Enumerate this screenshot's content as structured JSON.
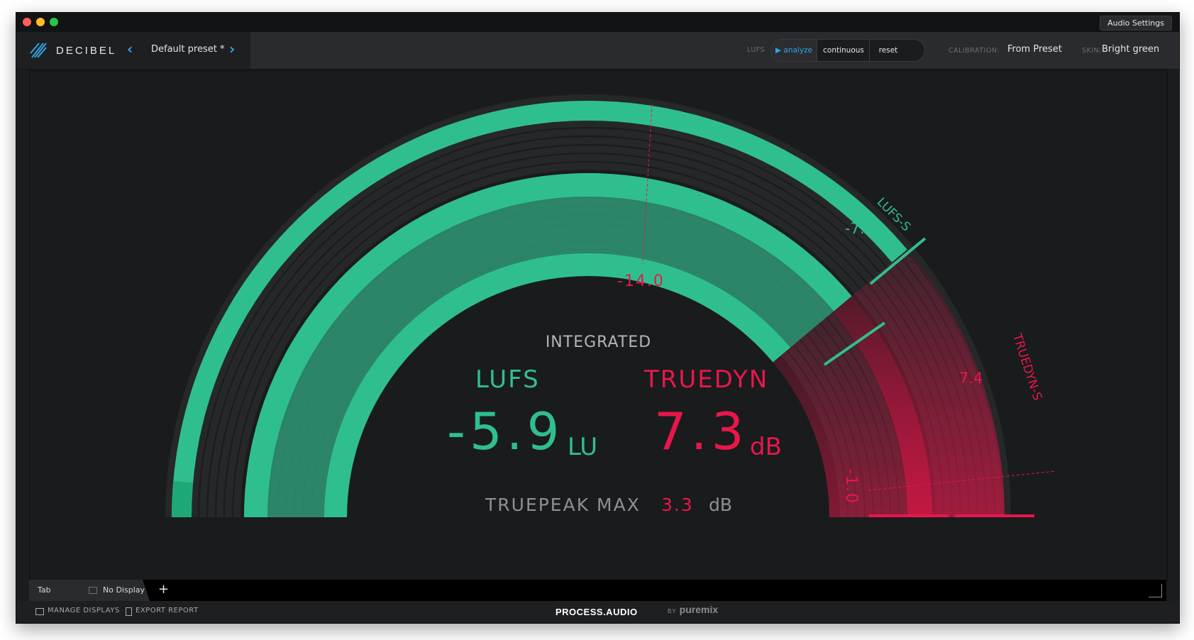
{
  "window": {
    "audio_settings_label": "Audio Settings"
  },
  "header": {
    "logo_text": "DECIBEL",
    "preset_name": "Default preset *",
    "lufs_label": "LUFS",
    "mode_buttons": [
      "analyze",
      "continuous",
      "reset"
    ],
    "active_mode": "analyze",
    "calibration_label": "CALIBRATION:",
    "calibration_value": "From Preset",
    "skin_label": "SKIN:",
    "skin_value": "Bright green"
  },
  "meter": {
    "integrated_label": "INTEGRATED",
    "lufs_title": "LUFS",
    "lufs_value": "-5.9",
    "lufs_unit": "LU",
    "truedyn_title": "TRUEDYN",
    "truedyn_value": "7.3",
    "truedyn_unit": "dB",
    "truepeak_label": "TRUEPEAK MAX",
    "truepeak_value": "3.3",
    "truepeak_unit": "dB",
    "lufs_s_label": "LUFS-S",
    "lufs_s_value": "-7.2",
    "truedyn_s_label": "TRUEDYN-S",
    "truedyn_s_value": "7.4",
    "target_marker_value": "-14.0",
    "threshold_marker_value": "-1.0",
    "colors": {
      "green": "#2fbf8f",
      "red": "#e8174a",
      "background": "#1a1b1d"
    }
  },
  "tabbar": {
    "tab_label": "Tab",
    "display_label": "No Display",
    "add_label": "+"
  },
  "footer": {
    "manage_displays": "MANAGE DISPLAYS",
    "export_report": "EXPORT REPORT",
    "brand": "PROCESS.AUDIO",
    "by_label": "BY",
    "partner": "puremix"
  }
}
